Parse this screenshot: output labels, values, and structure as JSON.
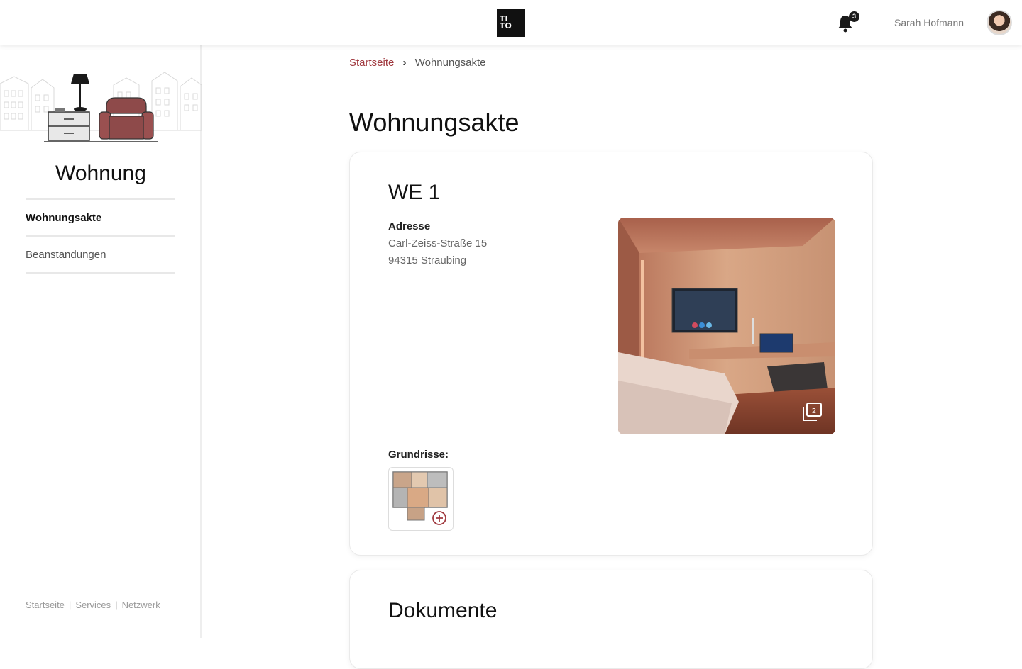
{
  "header": {
    "logo_line1": "TI",
    "logo_line2": "TO",
    "notification_count": "3",
    "user_name": "Sarah Hofmann",
    "icons": [
      "bell-icon",
      "avatar"
    ]
  },
  "sidebar": {
    "title": "Wohnung",
    "items": [
      {
        "label": "Wohnungsakte",
        "active": true
      },
      {
        "label": "Beanstandungen",
        "active": false
      }
    ],
    "footer_links": [
      "Startseite",
      "Services",
      "Netzwerk"
    ],
    "footer_separator": "|"
  },
  "breadcrumb": {
    "home": "Startseite",
    "current": "Wohnungsakte"
  },
  "page": {
    "title": "Wohnungsakte"
  },
  "unit": {
    "title": "WE 1",
    "address_label": "Adresse",
    "address_line1": "Carl-Zeiss-Straße 15",
    "address_line2": "94315 Straubing",
    "floorplans_label": "Grundrisse:"
  },
  "documents": {
    "title": "Dokumente"
  },
  "colors": {
    "accent": "#a0393f",
    "text": "#111111",
    "muted": "#777777"
  }
}
